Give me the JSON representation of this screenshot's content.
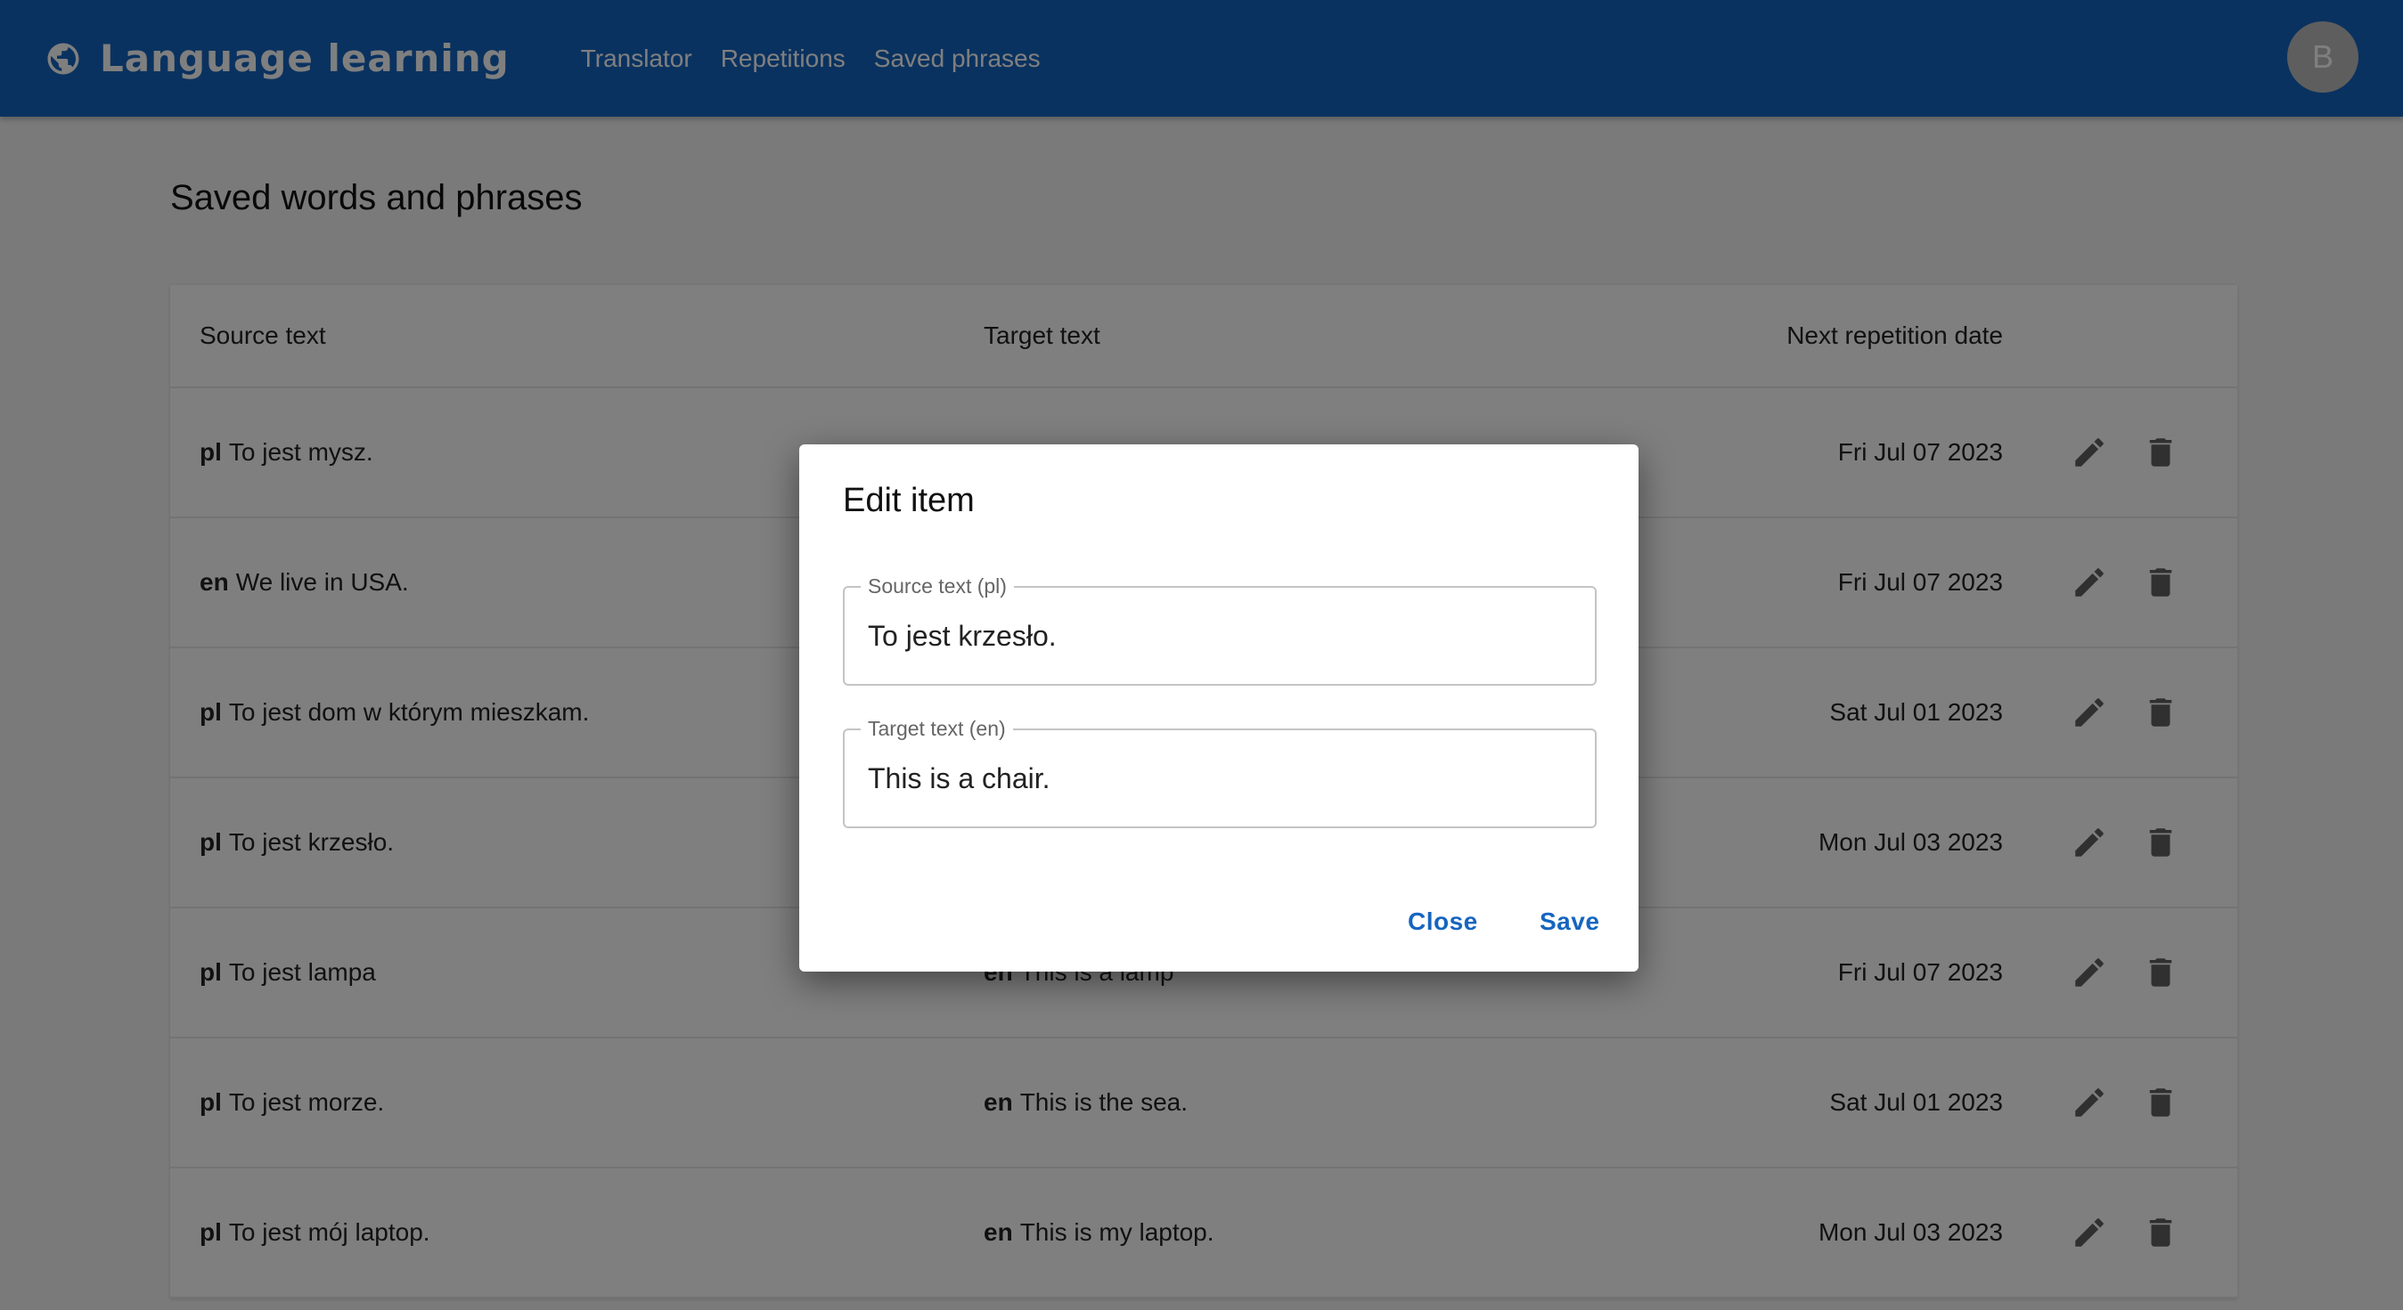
{
  "app": {
    "title": "Language learning",
    "avatar_letter": "B"
  },
  "nav": {
    "items": [
      "Translator",
      "Repetitions",
      "Saved phrases"
    ]
  },
  "page": {
    "title": "Saved words and phrases"
  },
  "table": {
    "headers": {
      "source": "Source text",
      "target": "Target text",
      "date": "Next repetition date"
    },
    "rows": [
      {
        "src_lang": "pl",
        "src": "To jest mysz.",
        "tgt_lang": "",
        "tgt": "",
        "date": "Fri Jul 07 2023"
      },
      {
        "src_lang": "en",
        "src": "We live in USA.",
        "tgt_lang": "",
        "tgt": "",
        "date": "Fri Jul 07 2023"
      },
      {
        "src_lang": "pl",
        "src": "To jest dom w którym mieszkam.",
        "tgt_lang": "",
        "tgt": "",
        "date": "Sat Jul 01 2023"
      },
      {
        "src_lang": "pl",
        "src": "To jest krzesło.",
        "tgt_lang": "",
        "tgt": "",
        "date": "Mon Jul 03 2023"
      },
      {
        "src_lang": "pl",
        "src": "To jest lampa",
        "tgt_lang": "en",
        "tgt": "This is a lamp",
        "date": "Fri Jul 07 2023"
      },
      {
        "src_lang": "pl",
        "src": "To jest morze.",
        "tgt_lang": "en",
        "tgt": "This is the sea.",
        "date": "Sat Jul 01 2023"
      },
      {
        "src_lang": "pl",
        "src": "To jest mój laptop.",
        "tgt_lang": "en",
        "tgt": "This is my laptop.",
        "date": "Mon Jul 03 2023"
      }
    ]
  },
  "dialog": {
    "title": "Edit item",
    "source": {
      "label": "Source text (pl)",
      "value": "To jest krzesło."
    },
    "target": {
      "label": "Target text (en)",
      "value": "This is a chair."
    },
    "close_label": "Close",
    "save_label": "Save"
  },
  "colors": {
    "appbar": "#1565c0",
    "accent": "#1565c0",
    "icon": "#616161"
  },
  "icons": {
    "brand": "globe-icon",
    "edit": "pencil-icon",
    "delete": "trash-icon"
  }
}
